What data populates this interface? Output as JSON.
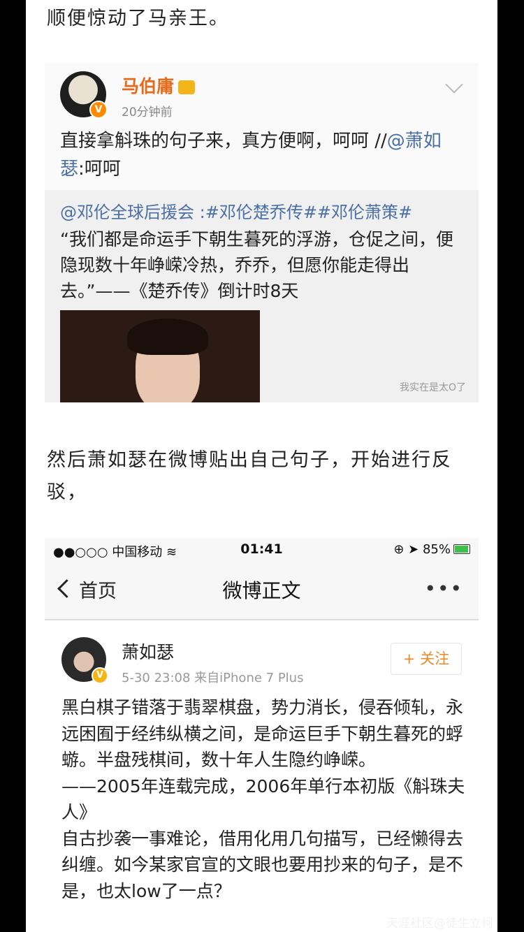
{
  "intro_text": "顺便惊动了马亲王。",
  "post1": {
    "author": "马伯庸",
    "time": "20分钟前",
    "verified_badge": "V",
    "text_main": "直接拿斛珠的句子来，真方便啊，呵呵 //",
    "mention": "@萧如瑟",
    "text_tail": ":呵呵",
    "quote_topic": "@邓伦全球后援会 :#邓伦楚乔传##邓伦萧策#",
    "quote_text": "“我们都是命运手下朝生暮死的浮游，仓促之间，便隐现数十年峥嵘冷热，乔乔，但愿你能走得出去。”——《楚乔传》倒计时8天",
    "watermark": "我实在是太O了"
  },
  "middle_text": "然后萧如瑟在微博贴出自己句子，开始进行反驳，",
  "phone": {
    "carrier": "●●○○○ 中国移动 ",
    "time": "01:41",
    "battery": "85%",
    "battery_level": 0.85,
    "back_label": "首页",
    "nav_title": "微博正文",
    "more": "•••"
  },
  "post2": {
    "author": "萧如瑟",
    "verified_badge": "V",
    "meta": "5-30 23:08  来自iPhone 7 Plus",
    "follow_label": "+ 关注",
    "body": "黑白棋子错落于翡翠棋盘，势力消长，侵吞倾轧，永远困囿于经纬纵横之间，是命运巨手下朝生暮死的蜉蝣。半盘残棋间，数十年人生隐约峥嵘。\n——2005年连载完成，2006年单行本初版《斛珠夫人》\n自古抄袭一事难论，借用化用几句描写，已经懒得去纠缠。如今某家官宣的文眼也要用抄来的句子，是不是，也太low了一点？"
  },
  "corner_watermark": "天涯社区@徒生立柯"
}
